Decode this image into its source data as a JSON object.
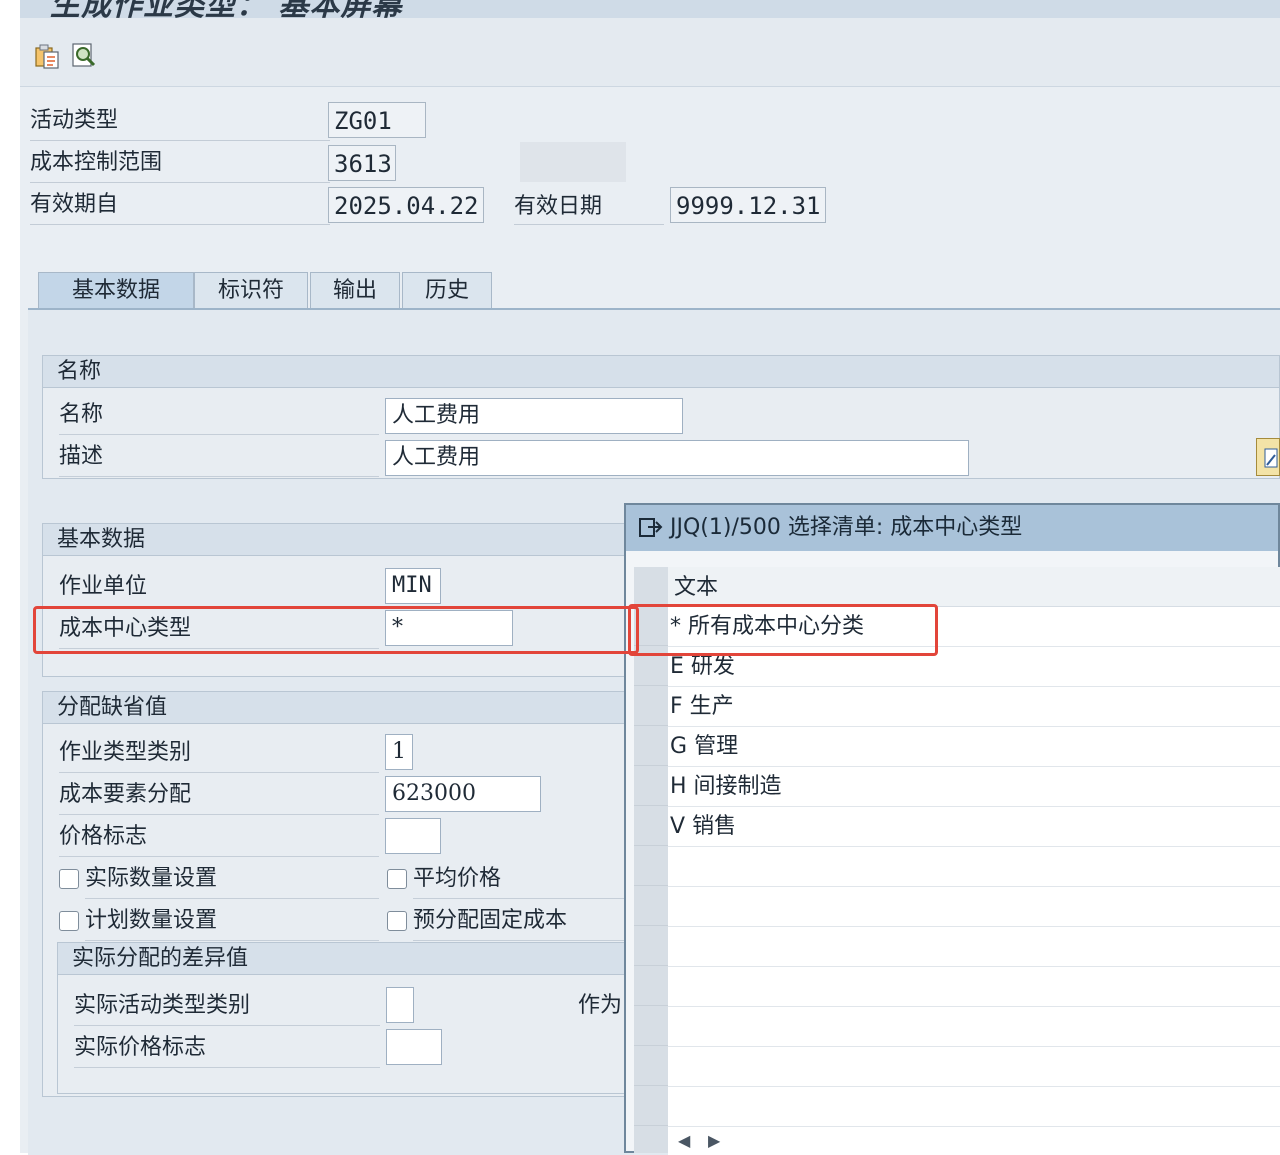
{
  "window": {
    "title": "生成作业类型： 基本屏幕"
  },
  "header": {
    "activity_type_label": "活动类型",
    "activity_type_value": "ZG01",
    "controlling_area_label": "成本控制范围",
    "controlling_area_value": "3613",
    "valid_from_label": "有效期自",
    "valid_from_value": "2025.04.22",
    "valid_to_label": "有效日期",
    "valid_to_value": "9999.12.31"
  },
  "tabs": [
    "基本数据",
    "标识符",
    "输出",
    "历史"
  ],
  "name_group": {
    "title": "名称",
    "name_label": "名称",
    "name_value": "人工费用",
    "desc_label": "描述",
    "desc_value": "人工费用"
  },
  "basic_group": {
    "title": "基本数据",
    "unit_label": "作业单位",
    "unit_value": "MIN",
    "cct_label": "成本中心类型",
    "cct_value": "*"
  },
  "alloc_group": {
    "title": "分配缺省值",
    "cat_label": "作业类型类别",
    "cat_value": "1",
    "cost_elem_label": "成本要素分配",
    "cost_elem_value": "623000",
    "price_ind_label": "价格标志",
    "price_ind_value": "",
    "actual_qty_label": "实际数量设置",
    "avg_price_label": "平均价格",
    "plan_qty_label": "计划数量设置",
    "prealloc_label": "预分配固定成本",
    "variance_title": "实际分配的差异值",
    "actual_cat_label": "实际活动类型类别",
    "actual_price_label": "实际价格标志",
    "as_label": "作为"
  },
  "popup": {
    "title": "JJQ(1)/500 选择清单: 成本中心类型",
    "column_header": "文本",
    "rows": [
      {
        "key": "*",
        "text": "所有成本中心分类"
      },
      {
        "key": "E",
        "text": "研发"
      },
      {
        "key": "F",
        "text": "生产"
      },
      {
        "key": "G",
        "text": "管理"
      },
      {
        "key": "H",
        "text": "间接制造"
      },
      {
        "key": "V",
        "text": "销售"
      }
    ]
  }
}
